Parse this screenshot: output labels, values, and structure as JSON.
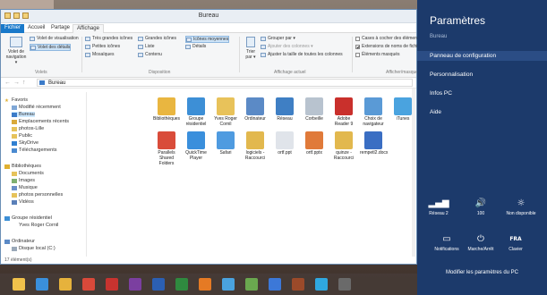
{
  "window": {
    "title": "Bureau"
  },
  "ribbon": {
    "tabs": [
      "Fichier",
      "Accueil",
      "Partage",
      "Affichage"
    ],
    "groups": {
      "volets": "Volets",
      "disposition": "Disposition",
      "affichage_actuel": "Affichage actuel",
      "afficher_masquer": "Afficher/masquer"
    },
    "volet_navigation": [
      "Volet de",
      "navigation ▾"
    ],
    "volet_visualisation": "Volet de visualisation",
    "volet_details": "Volet des détails",
    "layout_options": [
      "Très grandes icônes",
      "Grandes icônes",
      "Icônes moyennes",
      "Petites icônes",
      "Liste",
      "Détails",
      "Mosaïques",
      "Contenu"
    ],
    "trier_par": [
      "Trier",
      "par ▾"
    ],
    "current_view_options": [
      "Grouper par ▾",
      "Ajouter des colonnes ▾",
      "Ajuster la taille de toutes les colonnes"
    ],
    "show_hide": [
      {
        "label": "Cases à cocher des éléments",
        "checked": false
      },
      {
        "label": "Extensions de noms de fichiers",
        "checked": true
      },
      {
        "label": "Éléments masqués",
        "checked": false
      }
    ]
  },
  "address": {
    "path": "Bureau"
  },
  "nav": {
    "favoris": "Favoris",
    "favoris_items": [
      "Modifié récemment",
      "Bureau",
      "Emplacements récents",
      "photos-Lille",
      "Public",
      "SkyDrive",
      "Téléchargements"
    ],
    "bibliotheques": "Bibliothèques",
    "bibliotheques_items": [
      "Documents",
      "Images",
      "Musique",
      "photos personnelles",
      "Vidéos"
    ],
    "groupe": "Groupe résidentiel",
    "groupe_items": [
      "Yves Roger Cornil"
    ],
    "ordinateur": "Ordinateur",
    "ordinateur_items": [
      "Disque local (C:)"
    ]
  },
  "status": "17 élément(s)",
  "files": [
    {
      "label": "Bibliothèques",
      "icon": "library-icon",
      "color": "#e9b640"
    },
    {
      "label": "Groupe résidentiel",
      "icon": "homegroup-icon",
      "color": "#3d8fd6"
    },
    {
      "label": "Yves Roger Cornil",
      "icon": "user-folder-icon",
      "color": "#e8c25a"
    },
    {
      "label": "Ordinateur",
      "icon": "computer-icon",
      "color": "#5b8ac6"
    },
    {
      "label": "Réseau",
      "icon": "network-icon",
      "color": "#3f7fc4"
    },
    {
      "label": "Corbeille",
      "icon": "recycle-bin-icon",
      "color": "#b8c3cf"
    },
    {
      "label": "Adobe Reader 9",
      "icon": "pdf-icon",
      "color": "#c9302c"
    },
    {
      "label": "Choix de navigateur",
      "icon": "browser-choice-icon",
      "color": "#5a9ad6"
    },
    {
      "label": "iTunes",
      "icon": "itunes-icon",
      "color": "#4aa3df"
    },
    {
      "label": "Parallels Shared Folders",
      "icon": "shared-folder-icon",
      "color": "#d94c3a"
    },
    {
      "label": "QuickTime Player",
      "icon": "quicktime-icon",
      "color": "#3a8fdc"
    },
    {
      "label": "Safari",
      "icon": "safari-icon",
      "color": "#4f9be0"
    },
    {
      "label": "logiciels - Raccourci",
      "icon": "shortcut-folder-icon",
      "color": "#e2b84e"
    },
    {
      "label": "ortf.ppt",
      "icon": "ppt-icon",
      "color": "#e0e4ea"
    },
    {
      "label": "ortf.pptx",
      "icon": "pptx-icon",
      "color": "#e07a3a"
    },
    {
      "label": "quinze - Raccourci",
      "icon": "shortcut-folder-icon",
      "color": "#e2b84e"
    },
    {
      "label": "rempetl2.docx",
      "icon": "docx-icon",
      "color": "#3a6ec3"
    }
  ],
  "charms": {
    "title": "Paramètres",
    "context": "Bureau",
    "links": [
      "Panneau de configuration",
      "Personnalisation",
      "Infos PC",
      "Aide"
    ],
    "quick_settings": [
      {
        "label": "Réseau 2",
        "icon": "network-bars-icon"
      },
      {
        "label": "100",
        "icon": "volume-icon"
      },
      {
        "label": "Non disponible",
        "icon": "brightness-icon"
      },
      {
        "label": "Notifications",
        "icon": "notifications-icon"
      },
      {
        "label": "Marche/Arrêt",
        "icon": "power-icon"
      },
      {
        "label": "Clavier",
        "icon": "keyboard-icon",
        "glyph": "FRA"
      }
    ],
    "footer": "Modifier les paramètres du PC"
  },
  "taskbar": [
    {
      "name": "explorer-icon",
      "color": "#f0c14b"
    },
    {
      "name": "ie-icon",
      "color": "#3a8fdc"
    },
    {
      "name": "folder-icon",
      "color": "#e6b23c"
    },
    {
      "name": "chrome-icon",
      "color": "#d9493a"
    },
    {
      "name": "parallels-icon",
      "color": "#c8332f"
    },
    {
      "name": "calendar-icon",
      "color": "#7b3fa0"
    },
    {
      "name": "word-icon",
      "color": "#2b5fb3"
    },
    {
      "name": "excel-icon",
      "color": "#2f8a3f"
    },
    {
      "name": "firefox-icon",
      "color": "#e57a24"
    },
    {
      "name": "ie2-icon",
      "color": "#4aa3df"
    },
    {
      "name": "photos-icon",
      "color": "#6aa84f"
    },
    {
      "name": "media-icon",
      "color": "#3c78d8"
    },
    {
      "name": "remote-icon",
      "color": "#9b4a2a"
    },
    {
      "name": "skype-icon",
      "color": "#2fa8e0"
    },
    {
      "name": "app-icon",
      "color": "#6a6a6a"
    }
  ]
}
